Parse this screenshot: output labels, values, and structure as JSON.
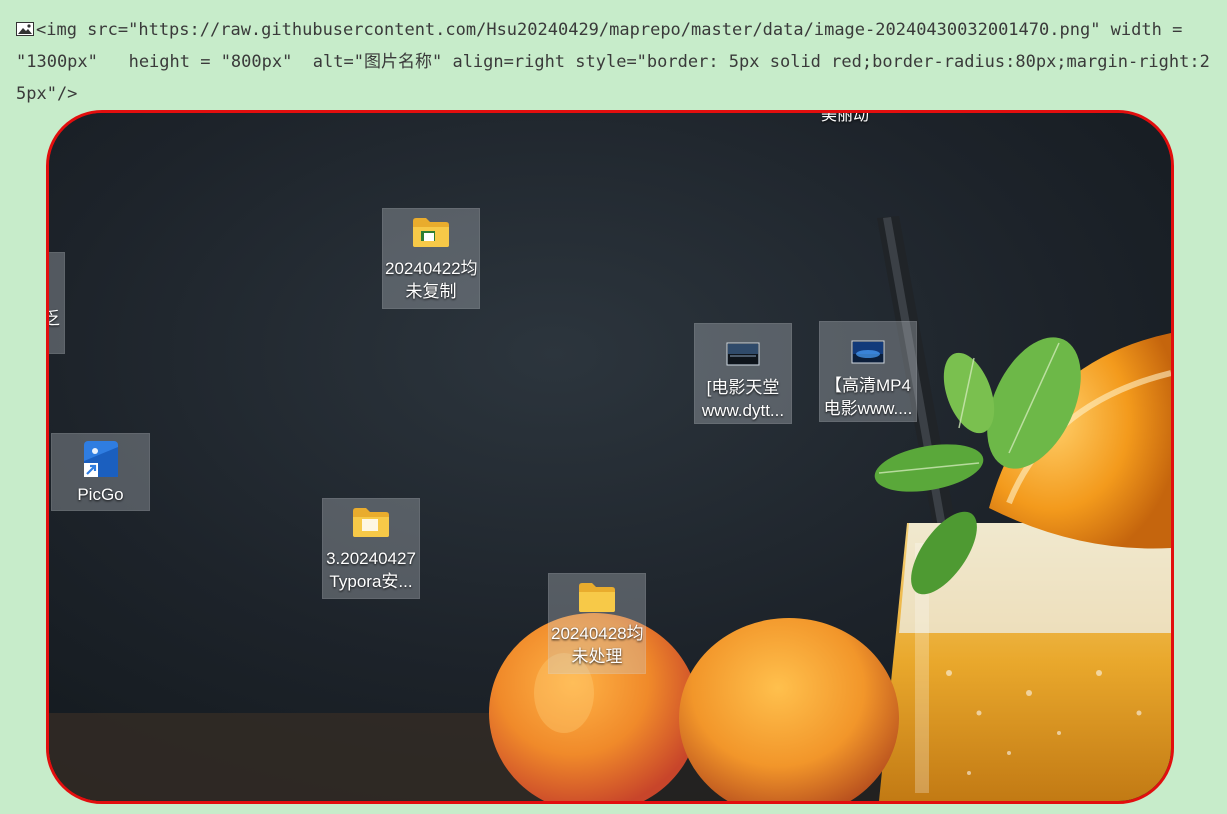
{
  "code": {
    "text": "<img src=\"https://raw.githubusercontent.com/Hsu20240429/maprepo/master/data/image-20240430032001470.png\" width = \"1300px\"   height = \"800px\"  alt=\"图片名称\" align=right style=\"border: 5px solid red;border-radius:80px;margin-right:25px\"/>"
  },
  "desktop": {
    "partial_top_label": "美丽动",
    "icons": [
      {
        "name": "folder-20240422",
        "line1": "20240422均",
        "line2": "未复制"
      },
      {
        "name": "video-dytt",
        "line1": "[电影天堂",
        "line2": "www.dytt..."
      },
      {
        "name": "video-hd-mp4",
        "line1": "【高清MP4",
        "line2": "电影www...."
      },
      {
        "name": "picgo",
        "line1": "PicGo",
        "line2": ""
      },
      {
        "name": "folder-typora",
        "line1": "3.20240427",
        "line2": "Typora安..."
      },
      {
        "name": "folder-20240428",
        "line1": "20240428均",
        "line2": "未处理"
      },
      {
        "name": "partial-left",
        "line1": "乏",
        "line2": ""
      }
    ]
  },
  "colors": {
    "page_bg": "#c7ecca",
    "frame_border": "#e20e0e",
    "folder": "#f7c948",
    "picgo_blue": "#2f7de1"
  }
}
